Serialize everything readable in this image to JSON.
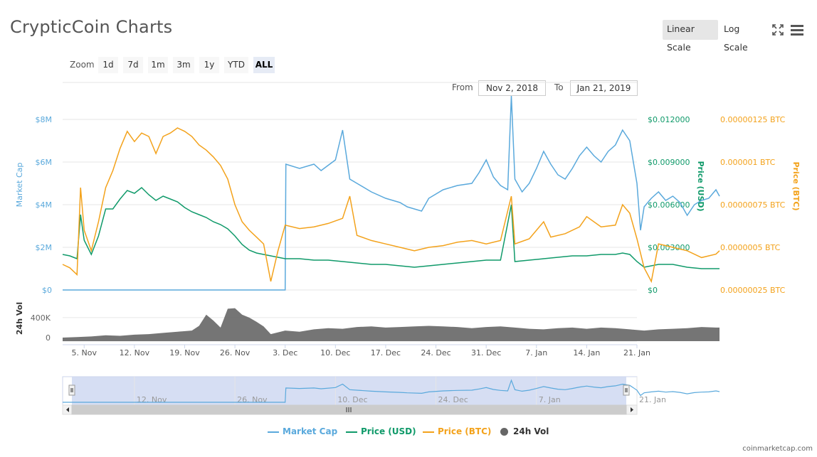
{
  "header": {
    "title": "CrypticCoin Charts",
    "linear_scale": "Linear Scale",
    "log_scale": "Log Scale"
  },
  "zoom": {
    "label": "Zoom",
    "buttons": [
      "1d",
      "7d",
      "1m",
      "3m",
      "1y",
      "YTD",
      "ALL"
    ],
    "active": "ALL"
  },
  "range": {
    "from_label": "From",
    "from_value": "Nov 2, 2018",
    "to_label": "To",
    "to_value": "Jan 21, 2019"
  },
  "colors": {
    "market_cap": "#5aa9dc",
    "price_usd": "#109a6a",
    "price_btc": "#f3a21b",
    "volume": "#666666"
  },
  "footer": "coinmarketcap.com",
  "chart_data": {
    "type": "line",
    "title": "",
    "x_start": "Nov 2, 2018",
    "x_end": "Jan 21, 2019",
    "x_ticks": [
      "5. Nov",
      "12. Nov",
      "19. Nov",
      "26. Nov",
      "3. Dec",
      "10. Dec",
      "17. Dec",
      "24. Dec",
      "31. Dec",
      "7. Jan",
      "14. Jan",
      "21. Jan"
    ],
    "navigator_ticks": [
      "12. Nov",
      "26. Nov",
      "10. Dec",
      "24. Dec",
      "7. Jan",
      "21. Jan"
    ],
    "axes": {
      "market_cap": {
        "label": "Market Cap",
        "ticks": [
          "$0",
          "$2M",
          "$4M",
          "$6M",
          "$8M"
        ],
        "ylim": [
          0,
          8000000
        ]
      },
      "price_usd": {
        "label": "Price (USD)",
        "ticks": [
          "$0",
          "$0.003000",
          "$0.006000",
          "$0.009000",
          "$0.012000"
        ],
        "ylim": [
          0,
          0.012
        ]
      },
      "price_btc": {
        "label": "Price (BTC)",
        "ticks": [
          "0.00000025 BTC",
          "0.0000005 BTC",
          "0.00000075 BTC",
          "0.000001 BTC",
          "0.00000125 BTC"
        ],
        "ylim": [
          2.5e-07,
          1.25e-06
        ]
      },
      "volume": {
        "label": "24h Vol",
        "ticks": [
          "0",
          "400K"
        ],
        "ylim": [
          0,
          700000
        ]
      }
    },
    "series": [
      {
        "name": "Market Cap",
        "key": "market_cap",
        "points": [
          [
            0,
            0
          ],
          [
            31,
            0
          ],
          [
            31.1,
            5900000
          ],
          [
            33,
            5700000
          ],
          [
            35,
            5900000
          ],
          [
            36,
            5600000
          ],
          [
            38,
            6100000
          ],
          [
            39,
            7500000
          ],
          [
            40,
            5200000
          ],
          [
            41,
            5000000
          ],
          [
            43,
            4600000
          ],
          [
            45,
            4300000
          ],
          [
            47,
            4100000
          ],
          [
            48,
            3900000
          ],
          [
            50,
            3700000
          ],
          [
            51,
            4300000
          ],
          [
            53,
            4700000
          ],
          [
            55,
            4900000
          ],
          [
            57,
            5000000
          ],
          [
            58,
            5500000
          ],
          [
            59,
            6100000
          ],
          [
            60,
            5300000
          ],
          [
            61,
            4900000
          ],
          [
            62,
            4700000
          ],
          [
            62.5,
            9100000
          ],
          [
            63,
            5200000
          ],
          [
            64,
            4600000
          ],
          [
            65,
            5000000
          ],
          [
            66,
            5700000
          ],
          [
            67,
            6500000
          ],
          [
            68,
            5900000
          ],
          [
            69,
            5400000
          ],
          [
            70,
            5200000
          ],
          [
            71,
            5700000
          ],
          [
            72,
            6300000
          ],
          [
            73,
            6700000
          ],
          [
            74,
            6300000
          ],
          [
            75,
            6000000
          ],
          [
            76,
            6500000
          ],
          [
            77,
            6800000
          ],
          [
            78,
            7500000
          ],
          [
            79,
            7000000
          ],
          [
            80,
            5000000
          ],
          [
            80.5,
            2800000
          ],
          [
            81,
            3900000
          ],
          [
            82,
            4300000
          ],
          [
            83,
            4600000
          ],
          [
            84,
            4200000
          ],
          [
            85,
            4400000
          ],
          [
            86,
            4100000
          ],
          [
            87,
            3500000
          ],
          [
            88,
            4000000
          ],
          [
            89,
            4200000
          ],
          [
            90,
            4300000
          ],
          [
            91,
            4700000
          ],
          [
            91.5,
            4400000
          ]
        ]
      },
      {
        "name": "Price (USD)",
        "key": "price_usd",
        "points": [
          [
            0,
            0.0025
          ],
          [
            1,
            0.0024
          ],
          [
            2,
            0.0022
          ],
          [
            2.5,
            0.0053
          ],
          [
            3,
            0.0035
          ],
          [
            4,
            0.0025
          ],
          [
            5,
            0.0038
          ],
          [
            6,
            0.0057
          ],
          [
            7,
            0.0057
          ],
          [
            8,
            0.0064
          ],
          [
            9,
            0.007
          ],
          [
            10,
            0.0068
          ],
          [
            11,
            0.0072
          ],
          [
            12,
            0.0067
          ],
          [
            13,
            0.0063
          ],
          [
            14,
            0.0066
          ],
          [
            15,
            0.0064
          ],
          [
            16,
            0.0062
          ],
          [
            17,
            0.0058
          ],
          [
            18,
            0.0055
          ],
          [
            19,
            0.0053
          ],
          [
            20,
            0.0051
          ],
          [
            21,
            0.0048
          ],
          [
            22,
            0.0046
          ],
          [
            23,
            0.0043
          ],
          [
            24,
            0.0038
          ],
          [
            25,
            0.0032
          ],
          [
            26,
            0.0028
          ],
          [
            27,
            0.0026
          ],
          [
            28,
            0.0025
          ],
          [
            29,
            0.0024
          ],
          [
            30,
            0.0023
          ],
          [
            31,
            0.0022
          ],
          [
            33,
            0.0022
          ],
          [
            35,
            0.0021
          ],
          [
            37,
            0.0021
          ],
          [
            39,
            0.002
          ],
          [
            41,
            0.0019
          ],
          [
            43,
            0.0018
          ],
          [
            45,
            0.0018
          ],
          [
            47,
            0.0017
          ],
          [
            49,
            0.0016
          ],
          [
            51,
            0.0017
          ],
          [
            53,
            0.0018
          ],
          [
            55,
            0.0019
          ],
          [
            57,
            0.002
          ],
          [
            59,
            0.0021
          ],
          [
            61,
            0.0021
          ],
          [
            62.5,
            0.006
          ],
          [
            63,
            0.002
          ],
          [
            65,
            0.0021
          ],
          [
            67,
            0.0022
          ],
          [
            69,
            0.0023
          ],
          [
            71,
            0.0024
          ],
          [
            73,
            0.0024
          ],
          [
            75,
            0.0025
          ],
          [
            77,
            0.0025
          ],
          [
            78,
            0.0026
          ],
          [
            79,
            0.0025
          ],
          [
            80,
            0.002
          ],
          [
            81,
            0.0016
          ],
          [
            83,
            0.0018
          ],
          [
            85,
            0.0018
          ],
          [
            87,
            0.0016
          ],
          [
            89,
            0.0015
          ],
          [
            91,
            0.0015
          ],
          [
            91.5,
            0.0015
          ]
        ]
      },
      {
        "name": "Price (BTC)",
        "key": "price_btc",
        "points": [
          [
            0,
            4e-07
          ],
          [
            1,
            3.8e-07
          ],
          [
            2,
            3.4e-07
          ],
          [
            2.5,
            8.5e-07
          ],
          [
            3,
            6e-07
          ],
          [
            4,
            4.8e-07
          ],
          [
            5,
            6.5e-07
          ],
          [
            6,
            8.5e-07
          ],
          [
            7,
            9.5e-07
          ],
          [
            8,
            1.08e-06
          ],
          [
            9,
            1.18e-06
          ],
          [
            10,
            1.12e-06
          ],
          [
            11,
            1.17e-06
          ],
          [
            12,
            1.15e-06
          ],
          [
            13,
            1.05e-06
          ],
          [
            14,
            1.15e-06
          ],
          [
            15,
            1.17e-06
          ],
          [
            16,
            1.2e-06
          ],
          [
            17,
            1.18e-06
          ],
          [
            18,
            1.15e-06
          ],
          [
            19,
            1.1e-06
          ],
          [
            20,
            1.07e-06
          ],
          [
            21,
            1.03e-06
          ],
          [
            22,
            9.8e-07
          ],
          [
            23,
            9e-07
          ],
          [
            24,
            7.5e-07
          ],
          [
            25,
            6.5e-07
          ],
          [
            26,
            6e-07
          ],
          [
            27,
            5.6e-07
          ],
          [
            28,
            5.2e-07
          ],
          [
            29,
            3e-07
          ],
          [
            30,
            4.8e-07
          ],
          [
            31,
            6.3e-07
          ],
          [
            33,
            6.1e-07
          ],
          [
            35,
            6.2e-07
          ],
          [
            37,
            6.4e-07
          ],
          [
            39,
            6.7e-07
          ],
          [
            40,
            8e-07
          ],
          [
            41,
            5.7e-07
          ],
          [
            43,
            5.4e-07
          ],
          [
            45,
            5.2e-07
          ],
          [
            47,
            5e-07
          ],
          [
            49,
            4.8e-07
          ],
          [
            51,
            5e-07
          ],
          [
            53,
            5.1e-07
          ],
          [
            55,
            5.3e-07
          ],
          [
            57,
            5.4e-07
          ],
          [
            59,
            5.2e-07
          ],
          [
            61,
            5.4e-07
          ],
          [
            62.5,
            8e-07
          ],
          [
            63,
            5.2e-07
          ],
          [
            65,
            5.5e-07
          ],
          [
            66,
            6e-07
          ],
          [
            67,
            6.5e-07
          ],
          [
            68,
            5.6e-07
          ],
          [
            70,
            5.8e-07
          ],
          [
            72,
            6.2e-07
          ],
          [
            73,
            6.8e-07
          ],
          [
            75,
            6.2e-07
          ],
          [
            77,
            6.3e-07
          ],
          [
            78,
            7.5e-07
          ],
          [
            79,
            7e-07
          ],
          [
            80,
            5.5e-07
          ],
          [
            81,
            3.8e-07
          ],
          [
            82,
            3e-07
          ],
          [
            83,
            5.2e-07
          ],
          [
            85,
            5e-07
          ],
          [
            87,
            4.8e-07
          ],
          [
            89,
            4.4e-07
          ],
          [
            91,
            4.6e-07
          ],
          [
            91.5,
            4.8e-07
          ]
        ]
      },
      {
        "name": "24h Vol",
        "key": "volume",
        "points": [
          [
            0,
            60000
          ],
          [
            2,
            70000
          ],
          [
            4,
            80000
          ],
          [
            6,
            100000
          ],
          [
            8,
            90000
          ],
          [
            10,
            110000
          ],
          [
            12,
            120000
          ],
          [
            14,
            140000
          ],
          [
            16,
            160000
          ],
          [
            18,
            180000
          ],
          [
            19,
            260000
          ],
          [
            20,
            450000
          ],
          [
            21,
            350000
          ],
          [
            22,
            230000
          ],
          [
            23,
            550000
          ],
          [
            24,
            560000
          ],
          [
            25,
            450000
          ],
          [
            26,
            400000
          ],
          [
            27,
            330000
          ],
          [
            28,
            250000
          ],
          [
            29,
            120000
          ],
          [
            31,
            180000
          ],
          [
            33,
            160000
          ],
          [
            35,
            200000
          ],
          [
            37,
            220000
          ],
          [
            39,
            210000
          ],
          [
            41,
            240000
          ],
          [
            43,
            250000
          ],
          [
            45,
            230000
          ],
          [
            47,
            240000
          ],
          [
            49,
            250000
          ],
          [
            51,
            260000
          ],
          [
            53,
            250000
          ],
          [
            55,
            240000
          ],
          [
            57,
            220000
          ],
          [
            59,
            240000
          ],
          [
            61,
            250000
          ],
          [
            63,
            230000
          ],
          [
            65,
            210000
          ],
          [
            67,
            200000
          ],
          [
            69,
            220000
          ],
          [
            71,
            230000
          ],
          [
            73,
            210000
          ],
          [
            75,
            230000
          ],
          [
            77,
            220000
          ],
          [
            79,
            200000
          ],
          [
            81,
            180000
          ],
          [
            83,
            200000
          ],
          [
            85,
            210000
          ],
          [
            87,
            220000
          ],
          [
            89,
            240000
          ],
          [
            91,
            230000
          ],
          [
            91.5,
            230000
          ]
        ]
      }
    ],
    "grid": true,
    "legend_placement": "bottom-center"
  }
}
